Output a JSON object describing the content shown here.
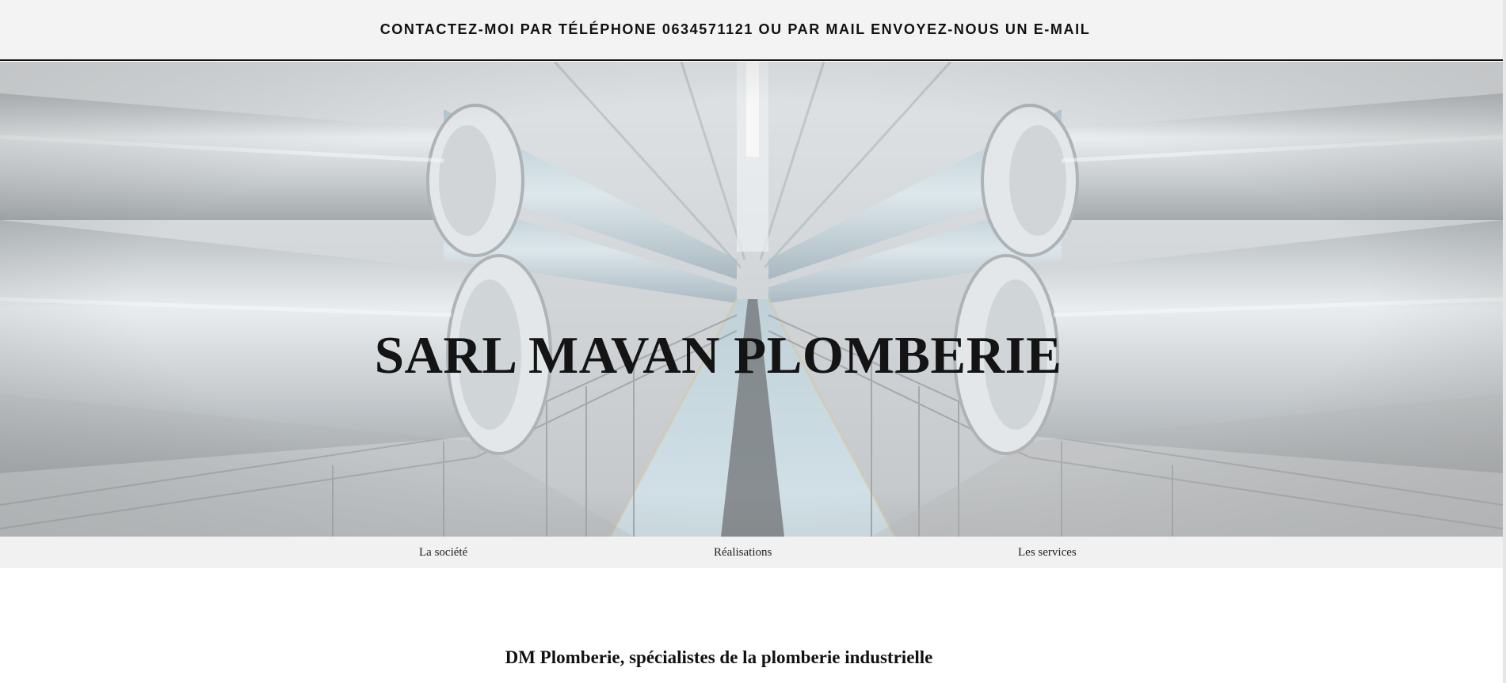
{
  "topbar": {
    "contact_text": "CONTACTEZ-MOI PAR TÉLÉPHONE 0634571121 OU PAR MAIL ENVOYEZ-NOUS UN E-MAIL"
  },
  "hero": {
    "title": "SARL MAVAN PLOMBERIE",
    "background": "industrial-pipes-corridor-photo"
  },
  "nav": {
    "items": [
      {
        "label": "La société"
      },
      {
        "label": "Réalisations"
      },
      {
        "label": "Les services"
      }
    ]
  },
  "main": {
    "heading": "DM Plomberie, spécialistes de la plomberie industrielle"
  },
  "colors": {
    "topbar_bg": "#f3f3f3",
    "nav_bg": "#f1f1f1",
    "text": "#111111",
    "accent_line": "#111111"
  }
}
